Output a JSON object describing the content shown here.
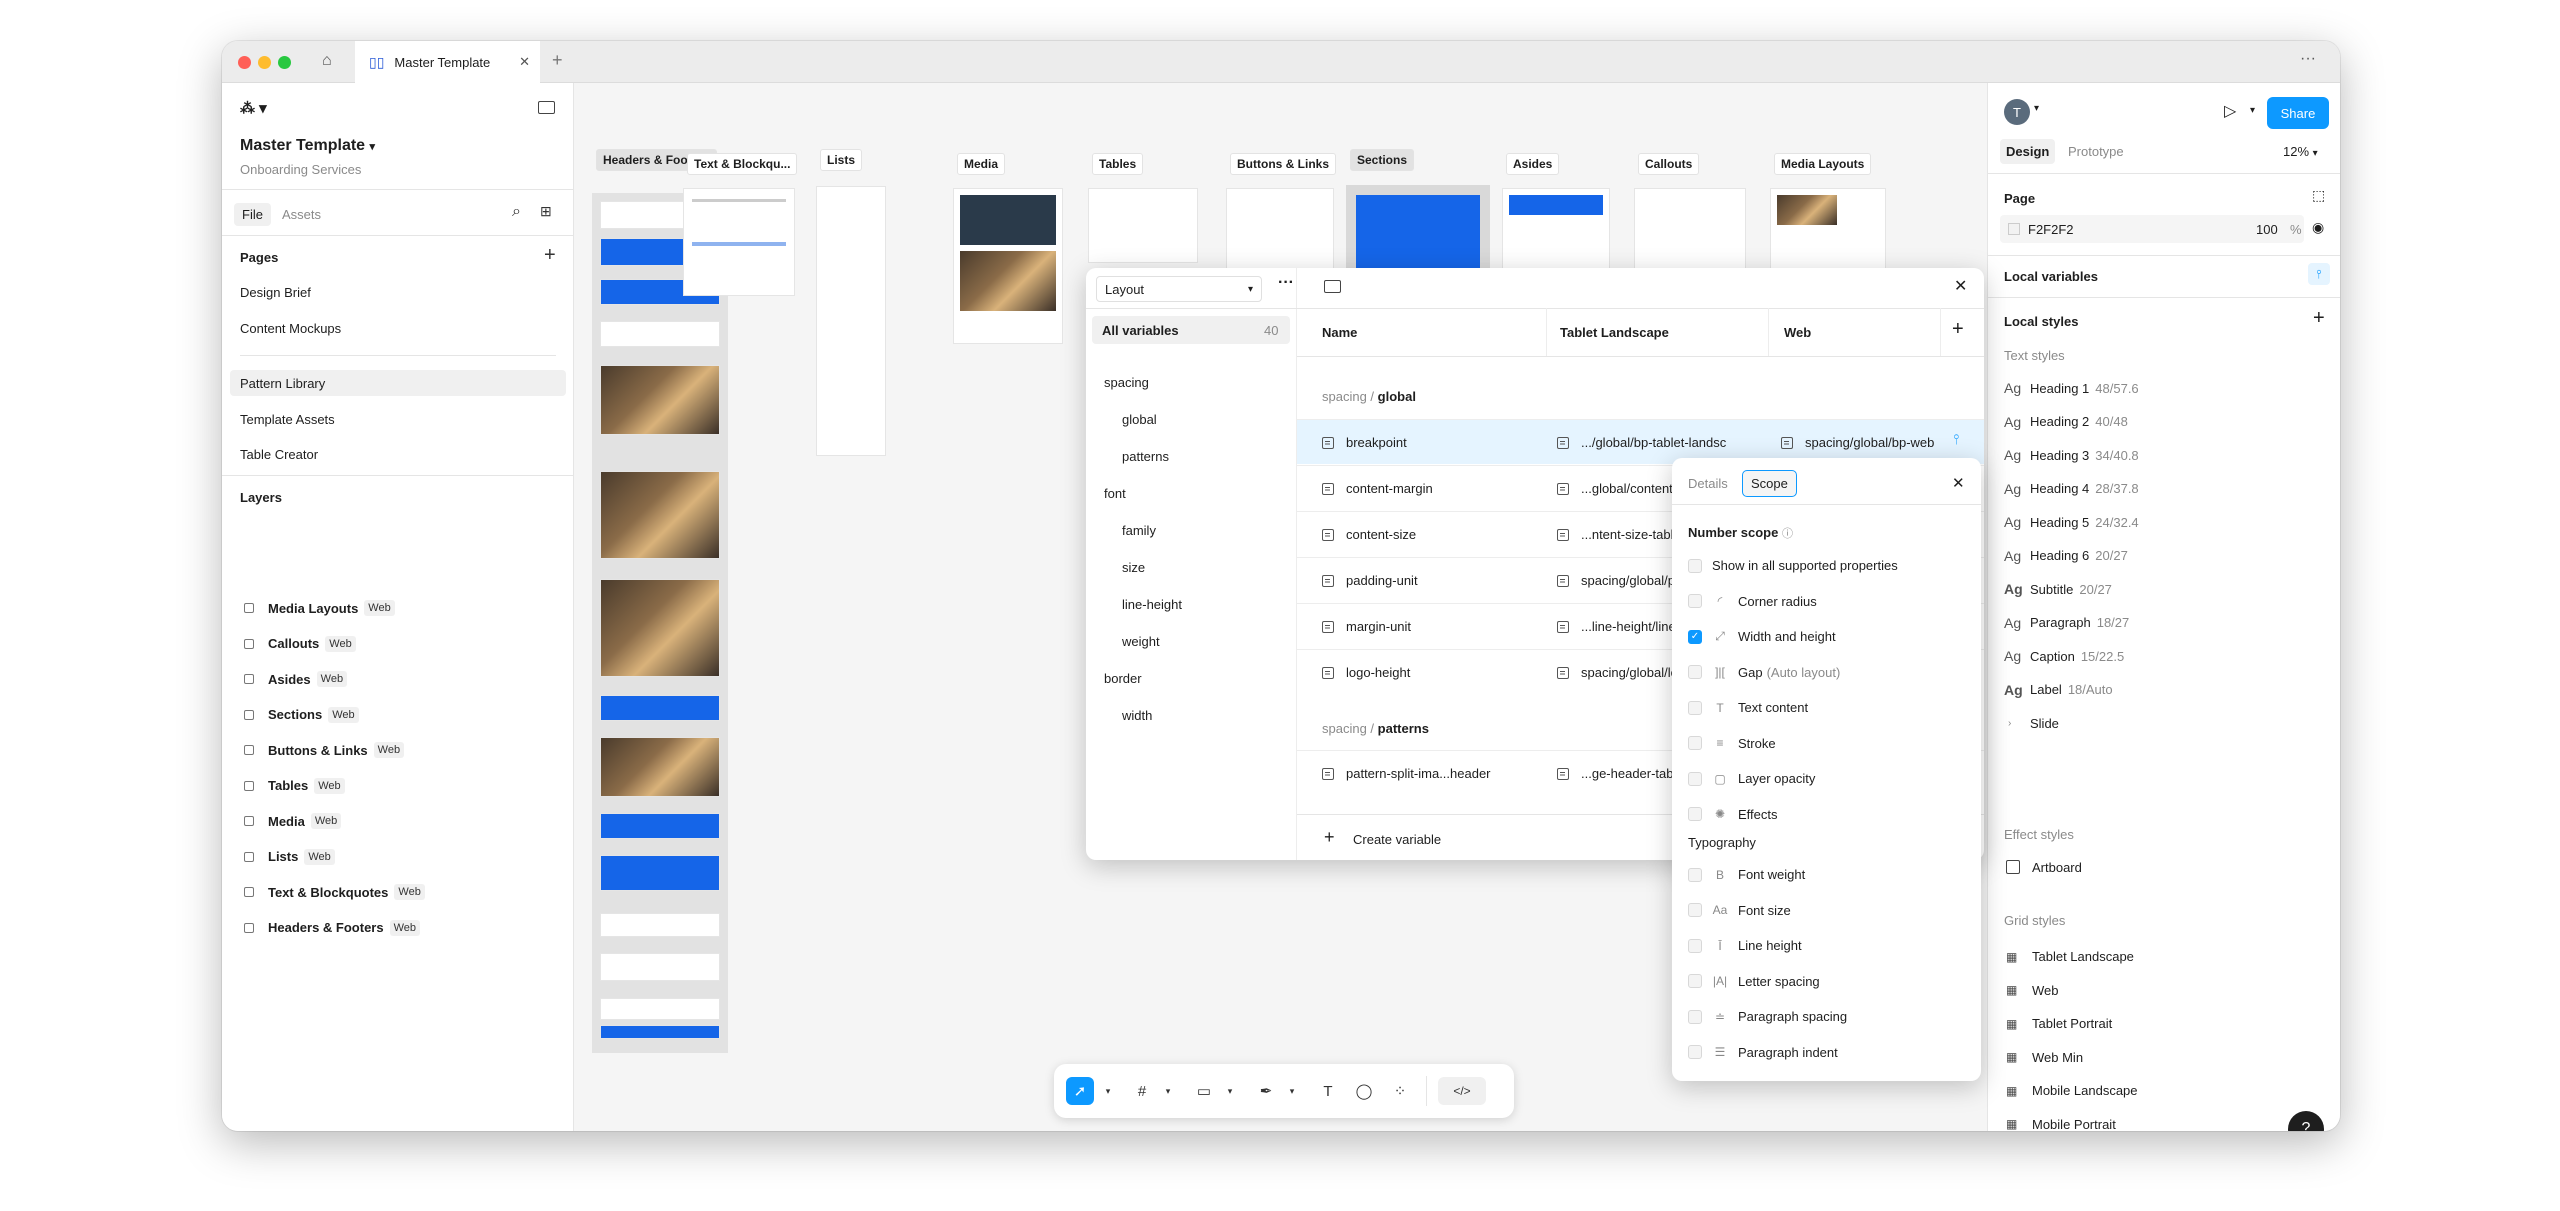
{
  "tab": {
    "title": "Master Template"
  },
  "file": {
    "name": "Master Template",
    "team": "Onboarding Services",
    "tab_file": "File",
    "tab_assets": "Assets"
  },
  "pages": {
    "heading": "Pages",
    "items": [
      "Design Brief",
      "Content Mockups",
      "Pattern Library",
      "Template Assets",
      "Table Creator"
    ]
  },
  "layers": {
    "heading": "Layers",
    "items": [
      {
        "name": "Media Layouts",
        "badge": "Web"
      },
      {
        "name": "Callouts",
        "badge": "Web"
      },
      {
        "name": "Asides",
        "badge": "Web"
      },
      {
        "name": "Sections",
        "badge": "Web"
      },
      {
        "name": "Buttons & Links",
        "badge": "Web"
      },
      {
        "name": "Tables",
        "badge": "Web"
      },
      {
        "name": "Media",
        "badge": "Web"
      },
      {
        "name": "Lists",
        "badge": "Web"
      },
      {
        "name": "Text & Blockquotes",
        "badge": "Web"
      },
      {
        "name": "Headers & Footers",
        "badge": "Web"
      }
    ]
  },
  "frames": [
    "Headers & Footers",
    "Text & Blockqu...",
    "Lists",
    "Media",
    "Tables",
    "Buttons & Links",
    "Sections",
    "Asides",
    "Callouts",
    "Media Layouts"
  ],
  "variables": {
    "collection": "Layout",
    "all_label": "All variables",
    "all_count": "40",
    "groups": [
      {
        "label": "spacing"
      },
      {
        "label": "global"
      },
      {
        "label": "patterns"
      },
      {
        "label": "font"
      },
      {
        "label": "family"
      },
      {
        "label": "size"
      },
      {
        "label": "line-height"
      },
      {
        "label": "weight"
      },
      {
        "label": "border"
      },
      {
        "label": "width"
      }
    ],
    "columns": [
      "Name",
      "Tablet Landscape",
      "Web"
    ],
    "section1_prefix": "spacing / ",
    "section1": "global",
    "rows": [
      {
        "name": "breakpoint",
        "tablet": ".../global/bp-tablet-landsc",
        "web": "spacing/global/bp-web"
      },
      {
        "name": "content-margin",
        "tablet": "...global/content-",
        "web": ""
      },
      {
        "name": "content-size",
        "tablet": "...ntent-size-tabl",
        "web": ""
      },
      {
        "name": "padding-unit",
        "tablet": "spacing/global/pa",
        "web": ""
      },
      {
        "name": "margin-unit",
        "tablet": "...line-height/line",
        "web": ""
      },
      {
        "name": "logo-height",
        "tablet": "spacing/global/lo",
        "web": ""
      }
    ],
    "section2_prefix": "spacing / ",
    "section2": "patterns",
    "rows2": [
      {
        "name": "pattern-split-ima...header",
        "tablet": "...ge-header-tabl"
      }
    ],
    "create": "Create variable"
  },
  "scope": {
    "tab_details": "Details",
    "tab_scope": "Scope",
    "number_scope": "Number scope",
    "items": [
      {
        "label": "Show in all supported properties",
        "checked": false,
        "icon": ""
      },
      {
        "label": "Corner radius",
        "checked": false,
        "icon": "◜"
      },
      {
        "label": "Width and height",
        "checked": true,
        "icon": "⤢"
      },
      {
        "label": "Gap",
        "extra": "(Auto layout)",
        "checked": false,
        "icon": "]|["
      },
      {
        "label": "Text content",
        "checked": false,
        "icon": "T"
      },
      {
        "label": "Stroke",
        "checked": false,
        "icon": "≡"
      },
      {
        "label": "Layer opacity",
        "checked": false,
        "icon": "▢"
      },
      {
        "label": "Effects",
        "checked": false,
        "icon": "✺"
      }
    ],
    "typography": "Typography",
    "typo_items": [
      {
        "label": "Font weight",
        "icon": "B"
      },
      {
        "label": "Font size",
        "icon": "Aa"
      },
      {
        "label": "Line height",
        "icon": "Ī"
      },
      {
        "label": "Letter spacing",
        "icon": "|A|"
      },
      {
        "label": "Paragraph spacing",
        "icon": "≐"
      },
      {
        "label": "Paragraph indent",
        "icon": "☰"
      }
    ]
  },
  "right": {
    "avatar": "T",
    "tab_design": "Design",
    "tab_prototype": "Prototype",
    "zoom": "12%",
    "share": "Share",
    "page_heading": "Page",
    "page_color": "F2F2F2",
    "page_opacity": "100",
    "percent": "%",
    "local_vars": "Local variables",
    "local_styles": "Local styles",
    "text_styles": "Text styles",
    "text_items": [
      {
        "name": "Heading 1",
        "meta": "48/57.6"
      },
      {
        "name": "Heading 2",
        "meta": "40/48"
      },
      {
        "name": "Heading 3",
        "meta": "34/40.8"
      },
      {
        "name": "Heading 4",
        "meta": "28/37.8"
      },
      {
        "name": "Heading 5",
        "meta": "24/32.4"
      },
      {
        "name": "Heading 6",
        "meta": "20/27"
      },
      {
        "name": "Subtitle",
        "meta": "20/27"
      },
      {
        "name": "Paragraph",
        "meta": "18/27"
      },
      {
        "name": "Caption",
        "meta": "15/22.5"
      },
      {
        "name": "Label",
        "meta": "18/Auto"
      }
    ],
    "slide": "Slide",
    "effect_styles": "Effect styles",
    "effect_item": "Artboard",
    "grid_styles": "Grid styles",
    "grid_items": [
      "Tablet Landscape",
      "Web",
      "Tablet Portrait",
      "Web Min",
      "Mobile Landscape",
      "Mobile Portrait"
    ],
    "help": "?"
  }
}
